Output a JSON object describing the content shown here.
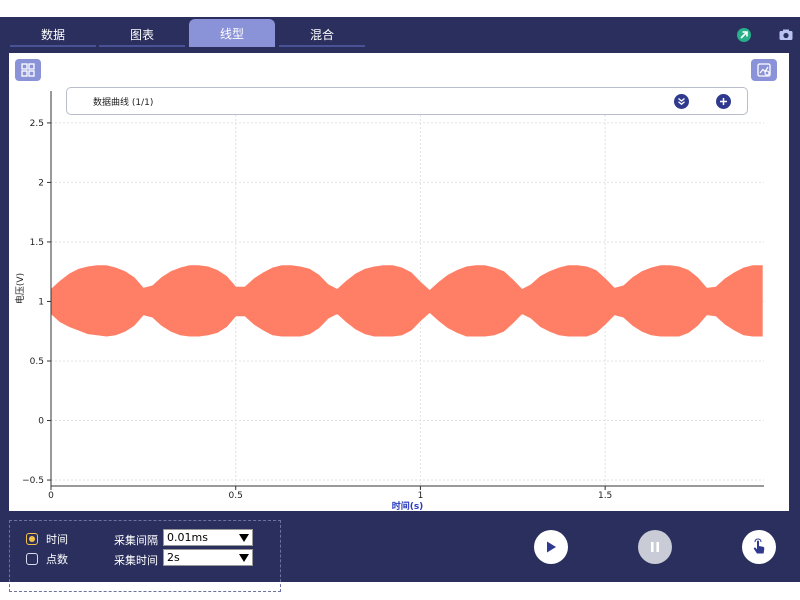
{
  "tabs": [
    {
      "label": "数据",
      "active": false
    },
    {
      "label": "图表",
      "active": false
    },
    {
      "label": "线型",
      "active": true
    },
    {
      "label": "混合",
      "active": false
    }
  ],
  "legend": {
    "label": "数据曲线 (1/1)"
  },
  "controls": {
    "mode_time_label": "时间",
    "mode_points_label": "点数",
    "interval_label": "采集间隔",
    "interval_value": "0.01ms",
    "duration_label": "采集时间",
    "duration_value": "2s"
  },
  "colors": {
    "frame": "#2b2f5d",
    "accent": "#8a93d8",
    "series": "#ff7f66",
    "axis_label": "#2a3bbd"
  },
  "chart_data": {
    "type": "area",
    "title": "",
    "xlabel": "时间(s)",
    "ylabel": "电压(V)",
    "xlim": [
      0,
      1.93
    ],
    "ylim": [
      -0.55,
      2.6
    ],
    "x_ticks": [
      0,
      0.5,
      1,
      1.5
    ],
    "x_tick_labels": [
      "0",
      "0.5",
      "1",
      "1.5"
    ],
    "y_ticks": [
      -0.5,
      0,
      0.5,
      1,
      1.5,
      2,
      2.5
    ],
    "y_tick_labels": [
      "−0.5",
      "0",
      "0.5",
      "1",
      "1.5",
      "2",
      "2.5"
    ],
    "grid": true,
    "series": [
      {
        "x": [
          0,
          0.025,
          0.05,
          0.075,
          0.1,
          0.125,
          0.15,
          0.175,
          0.2,
          0.225,
          0.25,
          0.275,
          0.3,
          0.325,
          0.35,
          0.375,
          0.4,
          0.425,
          0.45,
          0.475,
          0.5,
          0.525,
          0.55,
          0.575,
          0.6,
          0.625,
          0.65,
          0.675,
          0.7,
          0.725,
          0.75,
          0.775,
          0.8,
          0.825,
          0.85,
          0.875,
          0.9,
          0.925,
          0.95,
          0.975,
          1.0,
          1.025,
          1.05,
          1.075,
          1.1,
          1.125,
          1.15,
          1.175,
          1.2,
          1.225,
          1.25,
          1.275,
          1.3,
          1.325,
          1.35,
          1.375,
          1.4,
          1.425,
          1.45,
          1.475,
          1.5,
          1.525,
          1.55,
          1.575,
          1.6,
          1.625,
          1.65,
          1.675,
          1.7,
          1.725,
          1.75,
          1.775,
          1.8,
          1.825,
          1.85,
          1.875,
          1.9,
          1.925
        ],
        "upper": [
          1.1,
          1.17,
          1.23,
          1.27,
          1.29,
          1.3,
          1.3,
          1.28,
          1.25,
          1.2,
          1.11,
          1.13,
          1.2,
          1.25,
          1.28,
          1.3,
          1.3,
          1.29,
          1.26,
          1.21,
          1.12,
          1.12,
          1.19,
          1.24,
          1.28,
          1.3,
          1.3,
          1.29,
          1.27,
          1.22,
          1.14,
          1.1,
          1.17,
          1.23,
          1.27,
          1.29,
          1.3,
          1.3,
          1.28,
          1.24,
          1.16,
          1.09,
          1.16,
          1.22,
          1.26,
          1.29,
          1.3,
          1.3,
          1.28,
          1.25,
          1.18,
          1.1,
          1.14,
          1.21,
          1.25,
          1.28,
          1.3,
          1.3,
          1.29,
          1.26,
          1.19,
          1.11,
          1.13,
          1.2,
          1.25,
          1.28,
          1.3,
          1.3,
          1.29,
          1.26,
          1.2,
          1.11,
          1.12,
          1.19,
          1.24,
          1.28,
          1.3,
          1.3
        ],
        "lower": [
          0.9,
          0.83,
          0.79,
          0.76,
          0.73,
          0.72,
          0.71,
          0.72,
          0.75,
          0.8,
          0.89,
          0.87,
          0.8,
          0.75,
          0.72,
          0.71,
          0.71,
          0.72,
          0.74,
          0.79,
          0.88,
          0.88,
          0.81,
          0.76,
          0.72,
          0.71,
          0.71,
          0.71,
          0.73,
          0.78,
          0.86,
          0.9,
          0.83,
          0.77,
          0.73,
          0.71,
          0.71,
          0.71,
          0.72,
          0.76,
          0.84,
          0.91,
          0.84,
          0.78,
          0.74,
          0.71,
          0.71,
          0.71,
          0.72,
          0.75,
          0.82,
          0.9,
          0.86,
          0.79,
          0.75,
          0.72,
          0.71,
          0.71,
          0.71,
          0.74,
          0.81,
          0.89,
          0.87,
          0.8,
          0.75,
          0.72,
          0.71,
          0.71,
          0.71,
          0.74,
          0.8,
          0.89,
          0.88,
          0.81,
          0.76,
          0.72,
          0.71,
          0.71
        ]
      }
    ]
  }
}
